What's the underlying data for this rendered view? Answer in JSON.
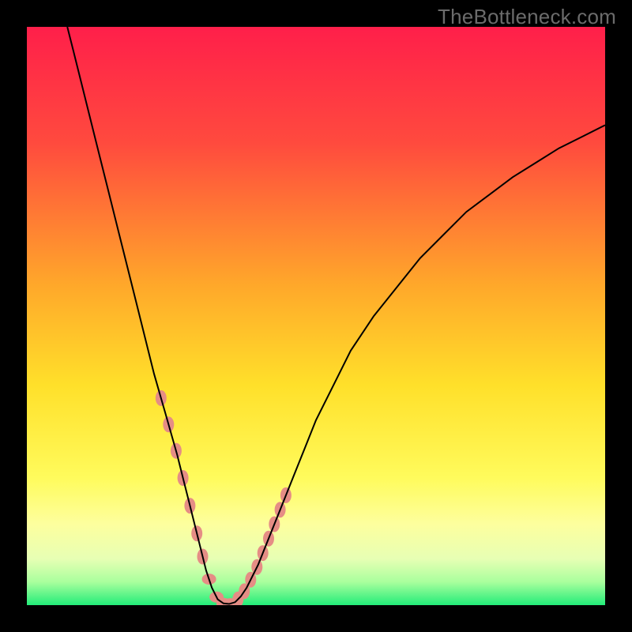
{
  "watermark": "TheBottleneck.com",
  "chart_data": {
    "type": "line",
    "title": "",
    "xlabel": "",
    "ylabel": "",
    "xlim": [
      0,
      100
    ],
    "ylim": [
      0,
      100
    ],
    "grid": false,
    "legend": false,
    "annotations": [],
    "background": {
      "type": "vertical-gradient",
      "stops": [
        {
          "offset": 0.0,
          "color": "#ff1f4a"
        },
        {
          "offset": 0.2,
          "color": "#ff4a3e"
        },
        {
          "offset": 0.45,
          "color": "#ffa92a"
        },
        {
          "offset": 0.62,
          "color": "#ffe02a"
        },
        {
          "offset": 0.78,
          "color": "#fffb5c"
        },
        {
          "offset": 0.86,
          "color": "#fdff9e"
        },
        {
          "offset": 0.92,
          "color": "#e7ffb4"
        },
        {
          "offset": 0.96,
          "color": "#a9ff9d"
        },
        {
          "offset": 1.0,
          "color": "#23ec79"
        }
      ]
    },
    "series": [
      {
        "name": "curve",
        "stroke": "#000000",
        "x": [
          7,
          8,
          10,
          12,
          14,
          16,
          18,
          20,
          22,
          24,
          26,
          27,
          28,
          29,
          30,
          31,
          32,
          33,
          34,
          35,
          36,
          37,
          38,
          40,
          42,
          44,
          46,
          48,
          50,
          53,
          56,
          60,
          64,
          68,
          72,
          76,
          80,
          84,
          88,
          92,
          96,
          100
        ],
        "y": [
          100,
          96,
          88,
          80,
          72,
          64,
          56,
          48,
          40,
          33,
          26,
          22,
          18,
          14,
          10,
          6,
          3,
          1,
          0.3,
          0.2,
          0.5,
          1.5,
          3,
          7,
          12,
          17,
          22,
          27,
          32,
          38,
          44,
          50,
          55,
          60,
          64,
          68,
          71,
          74,
          76.5,
          79,
          81,
          83
        ]
      }
    ],
    "markers": {
      "name": "highlight-dots",
      "color": "#e58d85",
      "x_range_groups": [
        {
          "x": [
            23.5,
            24.5,
            26,
            27,
            28.5,
            29.5,
            31,
            33,
            34.5,
            36,
            37,
            38,
            39,
            40,
            41,
            42,
            43,
            44
          ]
        },
        {
          "x": [
            23.5,
            24.5,
            26,
            27,
            28.5,
            29.5,
            31,
            33,
            34.5,
            36,
            37,
            38,
            39,
            40,
            41,
            42,
            43,
            44
          ]
        }
      ],
      "note": "markers lie on the curve in the low-y region; y derived from curve"
    }
  },
  "colors": {
    "frame": "#000000",
    "curve": "#000000",
    "marker": "#e58d85",
    "watermark": "#6b6b6b"
  }
}
